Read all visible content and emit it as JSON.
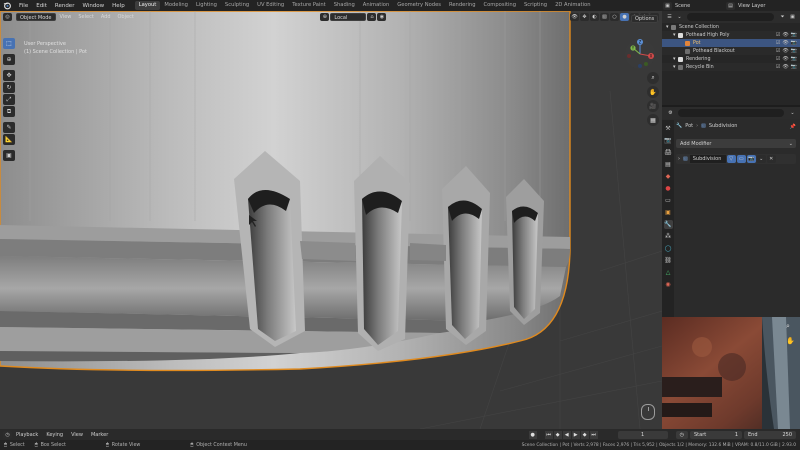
{
  "menus": [
    "File",
    "Edit",
    "Render",
    "Window",
    "Help"
  ],
  "workspaces": [
    {
      "label": "Layout",
      "active": true
    },
    {
      "label": "Modeling"
    },
    {
      "label": "Lighting"
    },
    {
      "label": "Sculpting"
    },
    {
      "label": "UV Editing"
    },
    {
      "label": "Texture Paint"
    },
    {
      "label": "Shading"
    },
    {
      "label": "Animation"
    },
    {
      "label": "Geometry Nodes"
    },
    {
      "label": "Rendering"
    },
    {
      "label": "Compositing"
    },
    {
      "label": "Scripting"
    },
    {
      "label": "2D Animation"
    }
  ],
  "top_right": {
    "scene": "Scene",
    "view_layer": "View Layer"
  },
  "viewport_header": {
    "mode": "Object Mode",
    "menus": [
      "View",
      "Select",
      "Add",
      "Object"
    ],
    "orientation": "Local",
    "options": "Options"
  },
  "viewport_info": {
    "line1": "User Perspective",
    "line2": "(1) Scene Collection | Pot"
  },
  "gizmo": {
    "x": "X",
    "y": "Y",
    "z": "Z"
  },
  "outliner": {
    "rows": [
      {
        "label": "Scene Collection",
        "indent": 0,
        "color": "#7a7a7a"
      },
      {
        "label": "Pothead High Poly",
        "indent": 1,
        "color": "#dcdcdc"
      },
      {
        "label": "Pot",
        "indent": 2,
        "color": "#e3853a",
        "selected": true
      },
      {
        "label": "Pothead Blackout",
        "indent": 2,
        "color": "#6d6d6d"
      },
      {
        "label": "Rendering",
        "indent": 1,
        "color": "#dcdcdc"
      },
      {
        "label": "Recycle Bin",
        "indent": 1,
        "color": "#6d6d6d"
      }
    ]
  },
  "properties": {
    "object_name": "Pot",
    "modifier_name": "Subdivision",
    "add_modifier": "Add Modifier",
    "modifier_row": "Subdivision"
  },
  "timeline": {
    "menus": [
      "Playback",
      "Keying",
      "View",
      "Marker"
    ],
    "current_frame": "1",
    "start_label": "Start",
    "start": "1",
    "end_label": "End",
    "end": "250"
  },
  "statusbar": {
    "select": "Select",
    "box_select": "Box Select",
    "rotate_view": "Rotate View",
    "context_menu": "Object Context Menu",
    "stats": "Scene Collection | Pot | Verts 2,978 | Faces 2,976 | Tris 5,952 | Objects 1/2 | Memory: 132.6 MiB | VRAM: 0.8/11.0 GiB | 2.93.0"
  },
  "colors": {
    "accent": "#4772b3",
    "selection_outline": "#e08a1e",
    "mesh": "#9a9a9a"
  }
}
